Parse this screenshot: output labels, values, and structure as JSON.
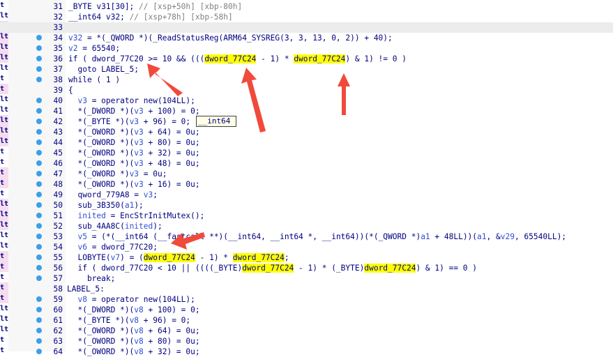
{
  "left_strip": {
    "labels": [
      "t",
      "lt",
      "lt",
      "lt",
      "lt",
      "lt",
      "lt",
      "t",
      "t",
      "lt",
      "lt",
      "lt",
      "lt",
      "lt",
      "t",
      "t",
      "t",
      "t",
      "t",
      "lt",
      "lt",
      "lt",
      "lt",
      "lt",
      "t",
      "t",
      "t",
      "t",
      "t",
      "lt",
      "lt",
      "lt",
      "t",
      "t"
    ],
    "pink_rows": [
      2,
      3,
      4,
      5,
      8,
      11,
      12,
      13,
      16,
      17,
      19,
      20,
      21,
      24,
      25,
      27,
      28
    ]
  },
  "tooltip": {
    "text": "__int64"
  },
  "lines": [
    {
      "num": "31",
      "dot": false,
      "parts": [
        {
          "t": "_BYTE v31[30]; ",
          "c": "def"
        },
        {
          "t": "// [xsp+50h] [xbp-80h]",
          "c": "cmt"
        }
      ]
    },
    {
      "num": "32",
      "dot": false,
      "parts": [
        {
          "t": "__int64 v32; ",
          "c": "def"
        },
        {
          "t": "// [xsp+78h] [xbp-58h]",
          "c": "cmt"
        }
      ]
    },
    {
      "num": "33",
      "dot": false,
      "hl": true,
      "parts": [
        {
          "t": "",
          "c": "def"
        }
      ]
    },
    {
      "num": "34",
      "dot": true,
      "parts": [
        {
          "t": "v32",
          "c": "var"
        },
        {
          "t": " = *(_QWORD *)(_ReadStatusReg(ARM64_SYSREG(3, 3, 13, 0, 2)) + 40);",
          "c": "def"
        }
      ]
    },
    {
      "num": "35",
      "dot": true,
      "parts": [
        {
          "t": "v2",
          "c": "var"
        },
        {
          "t": " = 65540;",
          "c": "def"
        }
      ]
    },
    {
      "num": "36",
      "dot": true,
      "parts": [
        {
          "t": "if ( dword_77C20 >= 10 && (((",
          "c": "def"
        },
        {
          "t": "dword_77C24",
          "c": "def",
          "hl": true
        },
        {
          "t": " - 1) * ",
          "c": "def"
        },
        {
          "t": "dword_77C24",
          "c": "def",
          "hl": true
        },
        {
          "t": ") & 1) != 0 )",
          "c": "def"
        }
      ]
    },
    {
      "num": "37",
      "dot": true,
      "parts": [
        {
          "t": "  goto LABEL_5;",
          "c": "def"
        }
      ]
    },
    {
      "num": "38",
      "dot": true,
      "parts": [
        {
          "t": "while ( 1 )",
          "c": "def"
        }
      ]
    },
    {
      "num": "39",
      "dot": false,
      "parts": [
        {
          "t": "{",
          "c": "def"
        }
      ]
    },
    {
      "num": "40",
      "dot": true,
      "parts": [
        {
          "t": "  ",
          "c": "def"
        },
        {
          "t": "v3",
          "c": "var"
        },
        {
          "t": " = operator new(104LL);",
          "c": "def"
        }
      ]
    },
    {
      "num": "41",
      "dot": true,
      "parts": [
        {
          "t": "  *(_DWORD *)(",
          "c": "def"
        },
        {
          "t": "v3",
          "c": "var"
        },
        {
          "t": " + 100) = 0;",
          "c": "def"
        }
      ]
    },
    {
      "num": "42",
      "dot": true,
      "parts": [
        {
          "t": "  *(_BYTE *)(",
          "c": "def"
        },
        {
          "t": "v3",
          "c": "var"
        },
        {
          "t": " + 96) = 0;",
          "c": "def"
        }
      ]
    },
    {
      "num": "43",
      "dot": true,
      "parts": [
        {
          "t": "  *(_OWORD *)(",
          "c": "def"
        },
        {
          "t": "v3",
          "c": "var"
        },
        {
          "t": " + 64) = 0u;",
          "c": "def"
        }
      ]
    },
    {
      "num": "44",
      "dot": true,
      "parts": [
        {
          "t": "  *(_OWORD *)(",
          "c": "def"
        },
        {
          "t": "v3",
          "c": "var"
        },
        {
          "t": " + 80) = 0u;",
          "c": "def"
        }
      ]
    },
    {
      "num": "45",
      "dot": true,
      "parts": [
        {
          "t": "  *(_OWORD *)(",
          "c": "def"
        },
        {
          "t": "v3",
          "c": "var"
        },
        {
          "t": " + 32) = 0u;",
          "c": "def"
        }
      ]
    },
    {
      "num": "46",
      "dot": true,
      "parts": [
        {
          "t": "  *(_OWORD *)(",
          "c": "def"
        },
        {
          "t": "v3",
          "c": "var"
        },
        {
          "t": " + 48) = 0u;",
          "c": "def"
        }
      ]
    },
    {
      "num": "47",
      "dot": true,
      "parts": [
        {
          "t": "  *(_OWORD *)",
          "c": "def"
        },
        {
          "t": "v3",
          "c": "var"
        },
        {
          "t": " = 0u;",
          "c": "def"
        }
      ]
    },
    {
      "num": "48",
      "dot": true,
      "parts": [
        {
          "t": "  *(_OWORD *)(",
          "c": "def"
        },
        {
          "t": "v3",
          "c": "var"
        },
        {
          "t": " + 16) = 0u;",
          "c": "def"
        }
      ]
    },
    {
      "num": "49",
      "dot": true,
      "parts": [
        {
          "t": "  qword_779A8 = ",
          "c": "def"
        },
        {
          "t": "v3",
          "c": "var"
        },
        {
          "t": ";",
          "c": "def"
        }
      ]
    },
    {
      "num": "50",
      "dot": true,
      "parts": [
        {
          "t": "  sub_3B350(",
          "c": "def"
        },
        {
          "t": "a1",
          "c": "var"
        },
        {
          "t": ");",
          "c": "def"
        }
      ]
    },
    {
      "num": "51",
      "dot": true,
      "parts": [
        {
          "t": "  ",
          "c": "def"
        },
        {
          "t": "inited",
          "c": "var"
        },
        {
          "t": " = EncStrInitMutex();",
          "c": "def"
        }
      ]
    },
    {
      "num": "52",
      "dot": true,
      "parts": [
        {
          "t": "  sub_4AA8C(",
          "c": "def"
        },
        {
          "t": "inited",
          "c": "var"
        },
        {
          "t": ");",
          "c": "def"
        }
      ]
    },
    {
      "num": "53",
      "dot": true,
      "parts": [
        {
          "t": "  ",
          "c": "def"
        },
        {
          "t": "v5",
          "c": "var"
        },
        {
          "t": " = (*(__int64 (__fastcall **)(__int64, __int64 *, __int64))(*(_QWORD *)",
          "c": "def"
        },
        {
          "t": "a1",
          "c": "var"
        },
        {
          "t": " + 48LL))(",
          "c": "def"
        },
        {
          "t": "a1",
          "c": "var"
        },
        {
          "t": ", &",
          "c": "def"
        },
        {
          "t": "v29",
          "c": "var"
        },
        {
          "t": ", 65540LL);",
          "c": "def"
        }
      ]
    },
    {
      "num": "54",
      "dot": true,
      "parts": [
        {
          "t": "  ",
          "c": "def"
        },
        {
          "t": "v6",
          "c": "var"
        },
        {
          "t": " = dword_77C20;",
          "c": "def"
        }
      ]
    },
    {
      "num": "55",
      "dot": true,
      "parts": [
        {
          "t": "  LOBYTE(",
          "c": "def"
        },
        {
          "t": "v7",
          "c": "var"
        },
        {
          "t": ") = (",
          "c": "def"
        },
        {
          "t": "dword_77C24",
          "c": "def",
          "hl": true
        },
        {
          "t": " - 1) * ",
          "c": "def"
        },
        {
          "t": "dword_77C24",
          "c": "def",
          "hl": true
        },
        {
          "t": ";",
          "c": "def"
        }
      ]
    },
    {
      "num": "56",
      "dot": true,
      "parts": [
        {
          "t": "  if ( dword_77C20 < 10 || ((((_BYTE)",
          "c": "def"
        },
        {
          "t": "dword_77C24",
          "c": "def",
          "hl": true
        },
        {
          "t": " - 1) * (_BYTE)",
          "c": "def"
        },
        {
          "t": "dword_77C24",
          "c": "def",
          "hl": true
        },
        {
          "t": ") & 1) == 0 )",
          "c": "def"
        }
      ]
    },
    {
      "num": "57",
      "dot": true,
      "parts": [
        {
          "t": "    break;",
          "c": "def"
        }
      ]
    },
    {
      "num": "58",
      "dot": false,
      "parts": [
        {
          "t": "}",
          "c": "def"
        }
      ],
      "label": "LABEL_5:"
    },
    {
      "num": "59",
      "dot": true,
      "parts": [
        {
          "t": "  ",
          "c": "def"
        },
        {
          "t": "v8",
          "c": "var"
        },
        {
          "t": " = operator new(104LL);",
          "c": "def"
        }
      ]
    },
    {
      "num": "60",
      "dot": true,
      "parts": [
        {
          "t": "  *(_DWORD *)(",
          "c": "def"
        },
        {
          "t": "v8",
          "c": "var"
        },
        {
          "t": " + 100) = 0;",
          "c": "def"
        }
      ]
    },
    {
      "num": "61",
      "dot": true,
      "parts": [
        {
          "t": "  *(_BYTE *)(",
          "c": "def"
        },
        {
          "t": "v8",
          "c": "var"
        },
        {
          "t": " + 96) = 0;",
          "c": "def"
        }
      ]
    },
    {
      "num": "62",
      "dot": true,
      "parts": [
        {
          "t": "  *(_OWORD *)(",
          "c": "def"
        },
        {
          "t": "v8",
          "c": "var"
        },
        {
          "t": " + 64) = 0u;",
          "c": "def"
        }
      ]
    },
    {
      "num": "63",
      "dot": true,
      "parts": [
        {
          "t": "  *(_OWORD *)(",
          "c": "def"
        },
        {
          "t": "v8",
          "c": "var"
        },
        {
          "t": " + 80) = 0u;",
          "c": "def"
        }
      ]
    },
    {
      "num": "64",
      "dot": true,
      "parts": [
        {
          "t": "  *(_OWORD *)(",
          "c": "def"
        },
        {
          "t": "v8",
          "c": "var"
        },
        {
          "t": " + 32) = 0u;",
          "c": "def"
        }
      ]
    }
  ],
  "colors": {
    "accent_arrow": "#f04a3c",
    "highlight": "#ffff00",
    "dot": "#3ca0e8",
    "line_number": "#000080"
  }
}
